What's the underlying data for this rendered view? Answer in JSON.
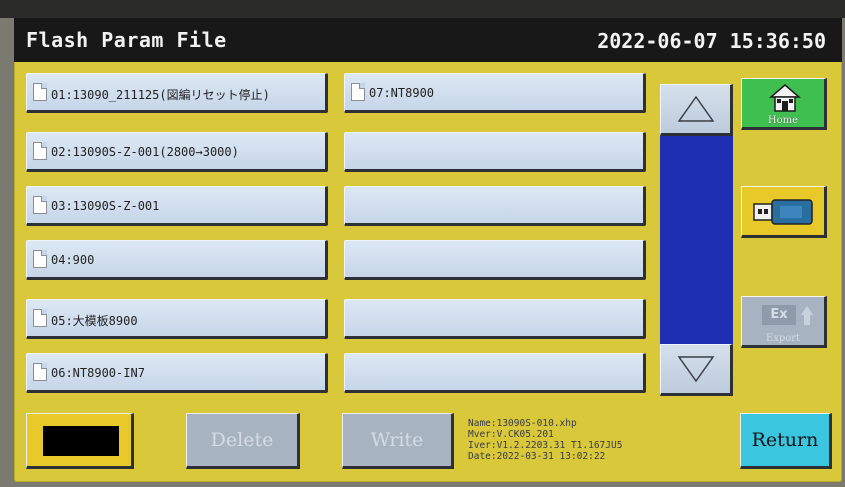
{
  "header": {
    "title": "Flash Param File",
    "datetime": "2022-06-07 15:36:50"
  },
  "files_left": [
    {
      "label": "01:13090_211125(図編リセット停止)"
    },
    {
      "label": "02:13090S-Z-001(2800→3000)"
    },
    {
      "label": "03:13090S-Z-001"
    },
    {
      "label": "04:900"
    },
    {
      "label": "05:大模板8900"
    },
    {
      "label": "06:NT8900-IN7"
    }
  ],
  "files_right": [
    {
      "label": "07:NT8900"
    },
    {
      "label": ""
    },
    {
      "label": ""
    },
    {
      "label": ""
    },
    {
      "label": ""
    },
    {
      "label": ""
    }
  ],
  "side": {
    "home_label": "Home",
    "export_label": "Export",
    "export_icon_text": "Ex"
  },
  "buttons": {
    "delete": "Delete",
    "write": "Write",
    "return": "Return"
  },
  "info": {
    "name": "Name:13090S-010.xhp",
    "mver": "Mver:V.CK05.201",
    "iver": "Iver:V1.2.2203.31 T1.167JU5",
    "date": "Date:2022-03-31 13:02:22"
  },
  "colors": {
    "background": "#d8c83a",
    "scroll_track": "#1f2fb4",
    "home": "#3fbf4f",
    "return": "#3bc6e0"
  }
}
